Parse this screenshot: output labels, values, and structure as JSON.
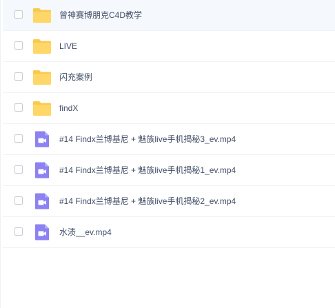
{
  "files": [
    {
      "name": "曾神赛博朋克C4D教学",
      "type": "folder",
      "icon": "folder-icon",
      "hovered": true
    },
    {
      "name": "LIVE",
      "type": "folder",
      "icon": "folder-icon",
      "hovered": false
    },
    {
      "name": "闪充案例",
      "type": "folder",
      "icon": "folder-icon",
      "hovered": false
    },
    {
      "name": "findX",
      "type": "folder",
      "icon": "folder-icon",
      "hovered": false
    },
    {
      "name": "#14 Findx兰博基尼 + 魅族live手机揭秘3_ev.mp4",
      "type": "video",
      "icon": "video-file-icon",
      "hovered": false
    },
    {
      "name": "#14 Findx兰博基尼 + 魅族live手机揭秘1_ev.mp4",
      "type": "video",
      "icon": "video-file-icon",
      "hovered": false
    },
    {
      "name": "#14 Findx兰博基尼 + 魅族live手机揭秘2_ev.mp4",
      "type": "video",
      "icon": "video-file-icon",
      "hovered": false
    },
    {
      "name": "水渍__ev.mp4",
      "type": "video",
      "icon": "video-file-icon",
      "hovered": false
    }
  ],
  "colors": {
    "folder": "#ffd768",
    "folder_tab": "#f9c94c",
    "video": "#8c82f2",
    "video_glyph": "#ffffff",
    "hover_row": "#f5f8fd",
    "text": "#424e67"
  }
}
